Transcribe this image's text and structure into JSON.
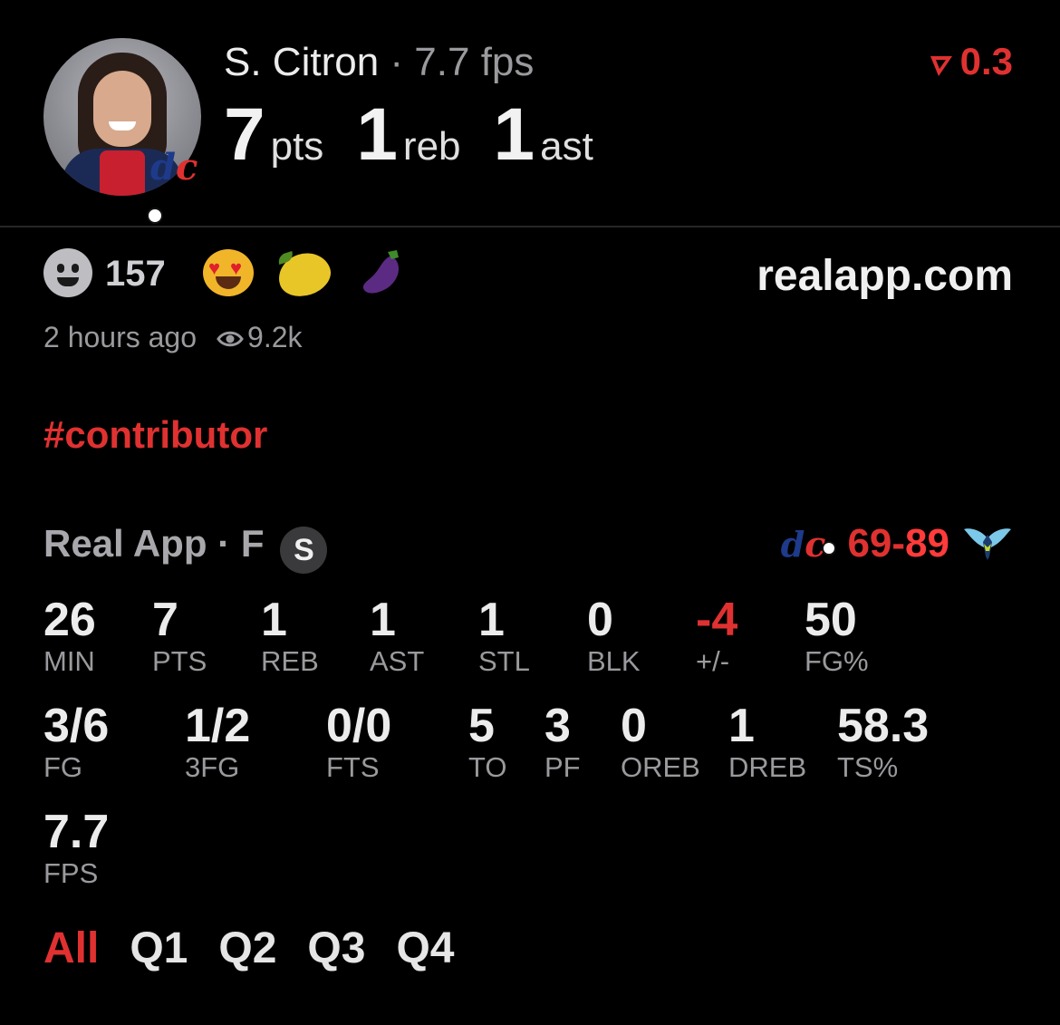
{
  "player": {
    "name": "S. Citron",
    "separator": "·",
    "fps_label": "7.7 fps",
    "points": "7",
    "points_unit": "pts",
    "rebounds": "1",
    "rebounds_unit": "reb",
    "assists": "1",
    "assists_unit": "ast",
    "delta": "0.3",
    "team_logo": "dc",
    "avatar_icon": "player-headshot"
  },
  "post": {
    "reaction_count": "157",
    "reactions": [
      "heart-eyes-emoji",
      "lemon-emoji",
      "eggplant-emoji"
    ],
    "site": "realapp.com",
    "time_ago": "2 hours ago",
    "views": "9.2k",
    "hashtag": "#contributor"
  },
  "game": {
    "source": "Real App",
    "separator": "·",
    "position": "F",
    "badge": "S",
    "home_logo": "dc",
    "home_score": "69",
    "dash": "-",
    "away_score": "89",
    "away_logo": "wings-icon"
  },
  "stats_row1": [
    {
      "value": "26",
      "label": "MIN"
    },
    {
      "value": "7",
      "label": "PTS"
    },
    {
      "value": "1",
      "label": "REB"
    },
    {
      "value": "1",
      "label": "AST"
    },
    {
      "value": "1",
      "label": "STL"
    },
    {
      "value": "0",
      "label": "BLK"
    },
    {
      "value": "-4",
      "label": "+/-"
    },
    {
      "value": "50",
      "label": "FG%"
    }
  ],
  "stats_row2": [
    {
      "value": "3/6",
      "label": "FG"
    },
    {
      "value": "1/2",
      "label": "3FG"
    },
    {
      "value": "0/0",
      "label": "FTS"
    },
    {
      "value": "5",
      "label": "TO"
    },
    {
      "value": "3",
      "label": "PF"
    },
    {
      "value": "0",
      "label": "OREB"
    },
    {
      "value": "1",
      "label": "DREB"
    },
    {
      "value": "58.3",
      "label": "TS%"
    }
  ],
  "stats_row3": [
    {
      "value": "7.7",
      "label": "FPS"
    }
  ],
  "tabs": [
    {
      "label": "All",
      "active": true
    },
    {
      "label": "Q1"
    },
    {
      "label": "Q2"
    },
    {
      "label": "Q3"
    },
    {
      "label": "Q4"
    }
  ],
  "colors": {
    "accent": "#e03131",
    "background": "#000000",
    "muted": "#9a9a9e"
  }
}
